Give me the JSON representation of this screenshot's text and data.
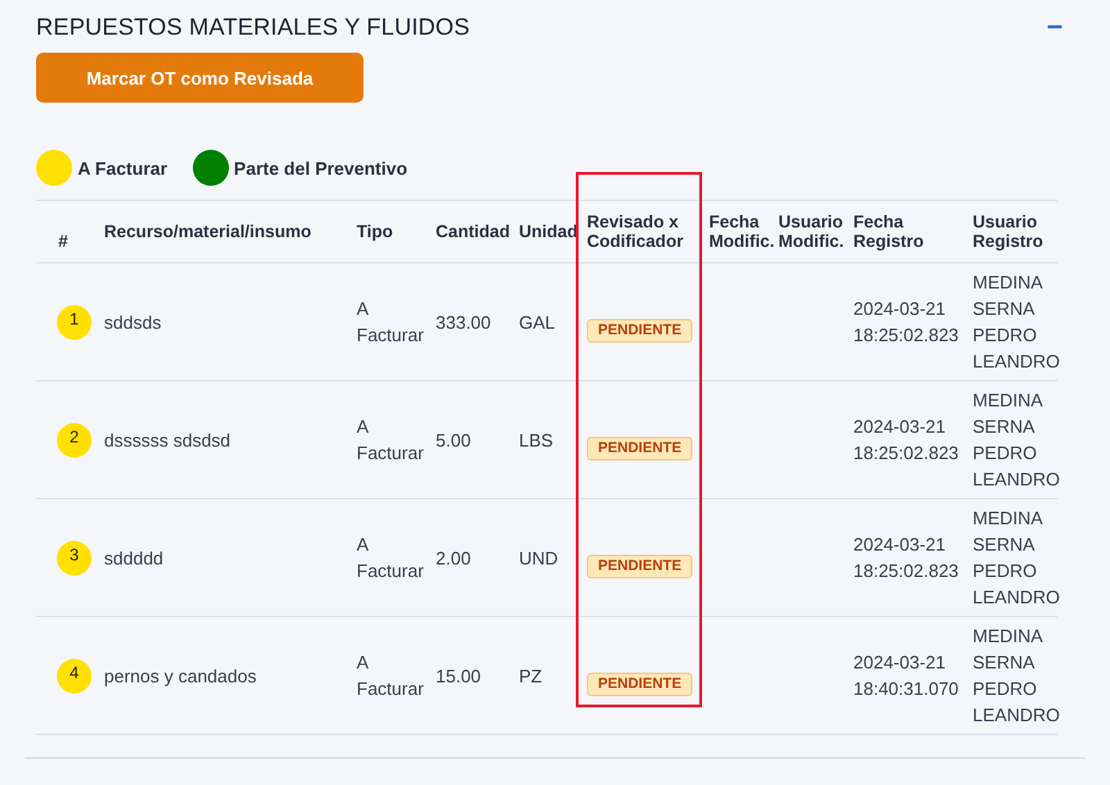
{
  "section": {
    "title": "REPUESTOS MATERIALES Y FLUIDOS",
    "collapse_icon": "−"
  },
  "action_button": "Marcar OT como Revisada",
  "legend": [
    {
      "label": "A Facturar",
      "color": "#ffe000"
    },
    {
      "label": "Parte del Preventivo",
      "color": "#008000"
    }
  ],
  "table": {
    "columns": [
      {
        "label": "#",
        "highlighted": false
      },
      {
        "label": "Recurso/material/insumo",
        "highlighted": false
      },
      {
        "label": "Tipo",
        "highlighted": false
      },
      {
        "label": "Cantidad",
        "highlighted": false
      },
      {
        "label": "Unidad",
        "highlighted": false
      },
      {
        "label": "Revisado x Codificador",
        "highlighted": true
      },
      {
        "label": "Fecha Modific.",
        "highlighted": false
      },
      {
        "label": "Usuario Modific.",
        "highlighted": false
      },
      {
        "label": "Fecha Registro",
        "highlighted": false
      },
      {
        "label": "Usuario Registro",
        "highlighted": false
      }
    ],
    "rows": [
      {
        "number": "1",
        "color": "#ffe000",
        "resource": "sddsds",
        "type": "A Facturar",
        "quantity": "333.00",
        "unit": "GAL",
        "status": "PENDIENTE",
        "registered_at": "2024-03-21 18:25:02.823",
        "registered_by": "MEDINA SERNA PEDRO LEANDRO"
      },
      {
        "number": "2",
        "color": "#ffe000",
        "resource": "dssssss sdsdsd",
        "type": "A Facturar",
        "quantity": "5.00",
        "unit": "LBS",
        "status": "PENDIENTE",
        "registered_at": "2024-03-21 18:25:02.823",
        "registered_by": "MEDINA SERNA PEDRO LEANDRO"
      },
      {
        "number": "3",
        "color": "#ffe000",
        "resource": "sddddd",
        "type": "A Facturar",
        "quantity": "2.00",
        "unit": "UND",
        "status": "PENDIENTE",
        "registered_at": "2024-03-21 18:25:02.823",
        "registered_by": "MEDINA SERNA PEDRO LEANDRO"
      },
      {
        "number": "4",
        "color": "#ffe000",
        "resource": "pernos y candados",
        "type": "A Facturar",
        "quantity": "15.00",
        "unit": "PZ",
        "status": "PENDIENTE",
        "registered_at": "2024-03-21 18:40:31.070",
        "registered_by": "MEDINA SERNA PEDRO LEANDRO"
      }
    ]
  }
}
